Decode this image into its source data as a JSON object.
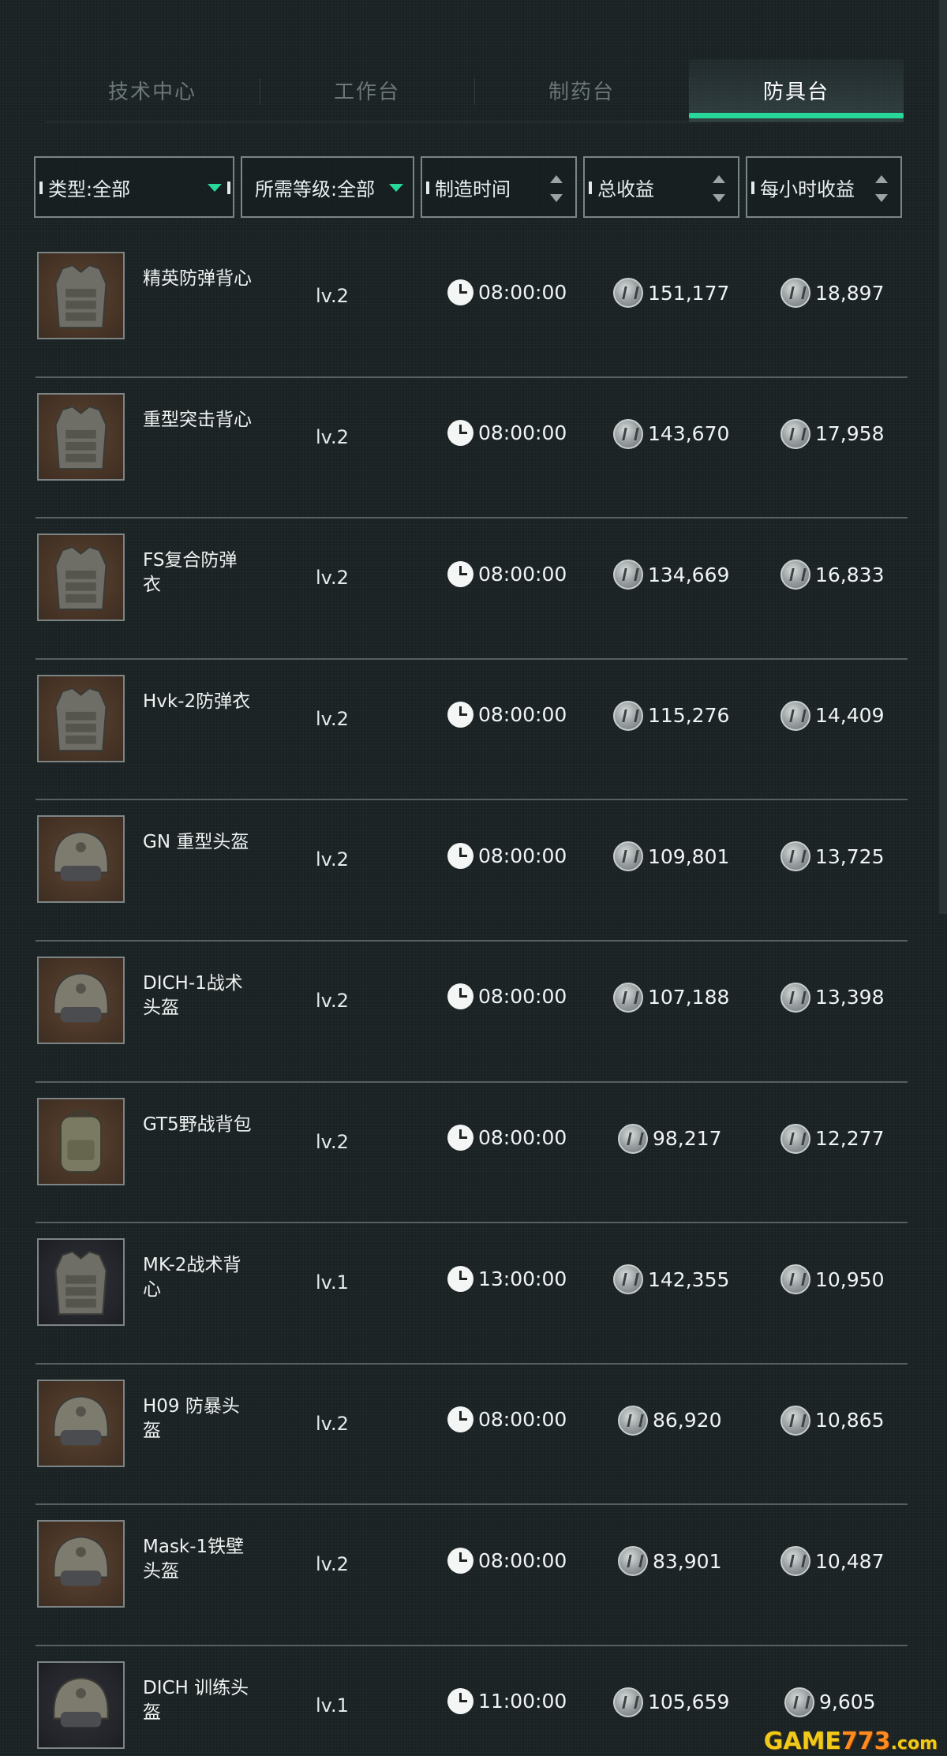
{
  "tabs": [
    {
      "label": "技术中心",
      "active": false
    },
    {
      "label": "工作台",
      "active": false
    },
    {
      "label": "制药台",
      "active": false
    },
    {
      "label": "防具台",
      "active": true
    }
  ],
  "filters": {
    "type": "类型:全部",
    "level": "所需等级:全部",
    "craft_time": "制造时间",
    "total_profit": "总收益",
    "hourly_profit": "每小时收益"
  },
  "colors": {
    "accent": "#27d89a",
    "background": "#1b2224"
  },
  "items": [
    {
      "name": "精英防弹背心",
      "level": "lv.2",
      "time": "08:00:00",
      "total": "151,177",
      "hourly": "18,897",
      "icon": "vest-icon",
      "thumb": "brown"
    },
    {
      "name": "重型突击背心",
      "level": "lv.2",
      "time": "08:00:00",
      "total": "143,670",
      "hourly": "17,958",
      "icon": "vest-icon",
      "thumb": "brown"
    },
    {
      "name": "FS复合防弹衣",
      "level": "lv.2",
      "time": "08:00:00",
      "total": "134,669",
      "hourly": "16,833",
      "icon": "vest-icon",
      "thumb": "brown"
    },
    {
      "name": "Hvk-2防弹衣",
      "level": "lv.2",
      "time": "08:00:00",
      "total": "115,276",
      "hourly": "14,409",
      "icon": "vest-icon",
      "thumb": "brown"
    },
    {
      "name": "GN 重型头盔",
      "level": "lv.2",
      "time": "08:00:00",
      "total": "109,801",
      "hourly": "13,725",
      "icon": "helmet-icon",
      "thumb": "brown"
    },
    {
      "name": "DICH-1战术头盔",
      "level": "lv.2",
      "time": "08:00:00",
      "total": "107,188",
      "hourly": "13,398",
      "icon": "helmet-icon",
      "thumb": "brown"
    },
    {
      "name": "GT5野战背包",
      "level": "lv.2",
      "time": "08:00:00",
      "total": "98,217",
      "hourly": "12,277",
      "icon": "backpack-icon",
      "thumb": "brown"
    },
    {
      "name": "MK-2战术背心",
      "level": "lv.1",
      "time": "13:00:00",
      "total": "142,355",
      "hourly": "10,950",
      "icon": "vest-icon",
      "thumb": "dark"
    },
    {
      "name": "H09 防暴头盔",
      "level": "lv.2",
      "time": "08:00:00",
      "total": "86,920",
      "hourly": "10,865",
      "icon": "helmet-icon",
      "thumb": "brown"
    },
    {
      "name": "Mask-1铁壁头盔",
      "level": "lv.2",
      "time": "08:00:00",
      "total": "83,901",
      "hourly": "10,487",
      "icon": "helmet-icon",
      "thumb": "brown"
    },
    {
      "name": "DICH 训练头盔",
      "level": "lv.1",
      "time": "11:00:00",
      "total": "105,659",
      "hourly": "9,605",
      "icon": "helmet-icon",
      "thumb": "dark"
    }
  ],
  "watermark": {
    "part1": "GAME",
    "part2": "773",
    "part3": ".com"
  }
}
